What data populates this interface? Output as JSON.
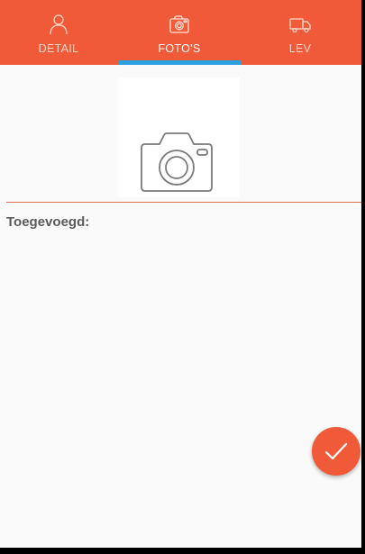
{
  "tabs": [
    {
      "label": "DETAIL",
      "icon": "person-icon",
      "active": false
    },
    {
      "label": "FOTO'S",
      "icon": "camera-icon",
      "active": true
    },
    {
      "label": "LEV",
      "icon": "truck-icon",
      "active": false
    }
  ],
  "photos": {
    "add_tile_icon": "camera-icon"
  },
  "added_section": {
    "label": "Toegevoegd:"
  },
  "fab": {
    "icon": "checkmark-icon"
  },
  "colors": {
    "accent": "#f05a38",
    "tab_indicator": "#2ba1e0",
    "background": "#fafafa",
    "label_text": "#5a5a5a"
  }
}
